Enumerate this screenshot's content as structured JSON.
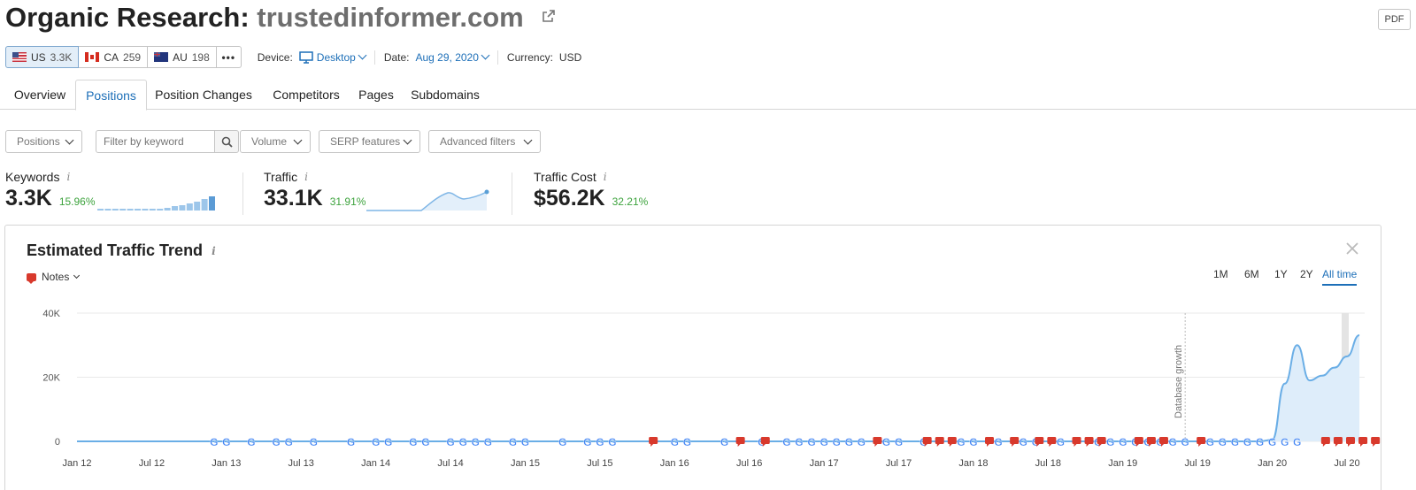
{
  "header": {
    "title_prefix": "Organic Research:",
    "domain": "trustedinformer.com",
    "pdf_label": "PDF"
  },
  "databases": [
    {
      "code": "US",
      "count": "3.3K",
      "flag": "us",
      "active": true
    },
    {
      "code": "CA",
      "count": "259",
      "flag": "ca",
      "active": false
    },
    {
      "code": "AU",
      "count": "198",
      "flag": "au",
      "active": false
    }
  ],
  "more_label": "•••",
  "device": {
    "label": "Device:",
    "value": "Desktop"
  },
  "date": {
    "label": "Date:",
    "value": "Aug 29, 2020"
  },
  "currency": {
    "label": "Currency:",
    "value": "USD"
  },
  "tabs": [
    "Overview",
    "Positions",
    "Position Changes",
    "Competitors",
    "Pages",
    "Subdomains"
  ],
  "active_tab": "Positions",
  "filters": {
    "positions": "Positions",
    "keyword_placeholder": "Filter by keyword",
    "volume": "Volume",
    "serp": "SERP features",
    "advanced": "Advanced filters"
  },
  "metrics": [
    {
      "label": "Keywords",
      "value": "3.3K",
      "change": "15.96%"
    },
    {
      "label": "Traffic",
      "value": "33.1K",
      "change": "31.91%"
    },
    {
      "label": "Traffic Cost",
      "value": "$56.2K",
      "change": "32.21%"
    }
  ],
  "info_glyph": "i",
  "panel": {
    "title": "Estimated Traffic Trend",
    "notes_label": "Notes",
    "periods": [
      "1M",
      "6M",
      "1Y",
      "2Y",
      "All time"
    ],
    "active_period": "All time"
  },
  "colors": {
    "accent": "#1d6fb8",
    "positive": "#3da33d",
    "line": "#6aaee6",
    "area": "#deedfa",
    "note": "#d8392c"
  },
  "chart_data": {
    "type": "area",
    "title": "Estimated Traffic Trend",
    "y_ticks": [
      "40K",
      "20K",
      "0"
    ],
    "ylim": [
      0,
      40000
    ],
    "x_ticks": [
      "Jan 12",
      "Jul 12",
      "Jan 13",
      "Jul 13",
      "Jan 14",
      "Jul 14",
      "Jan 15",
      "Jul 15",
      "Jan 16",
      "Jul 16",
      "Jan 17",
      "Jul 17",
      "Jan 18",
      "Jul 18",
      "Jan 19",
      "Jul 19",
      "Jan 20",
      "Jul 20"
    ],
    "annotation": "Database growth",
    "series": [
      {
        "x": [
          "2012-01",
          "2019-12",
          "2020-01",
          "2020-02",
          "2020-03",
          "2020-04",
          "2020-05",
          "2020-06",
          "2020-07",
          "2020-08"
        ],
        "values": [
          0,
          0,
          500,
          18000,
          30000,
          19000,
          20500,
          23000,
          26500,
          33100
        ]
      }
    ],
    "markers": {
      "google_update": [
        "2012-12",
        "2013-01",
        "2013-03",
        "2013-05",
        "2013-06",
        "2013-08",
        "2013-11",
        "2014-01",
        "2014-02",
        "2014-04",
        "2014-05",
        "2014-07",
        "2014-08",
        "2014-09",
        "2014-10",
        "2014-12",
        "2015-01",
        "2015-04",
        "2015-06",
        "2015-07",
        "2015-08",
        "2016-01",
        "2016-02",
        "2016-05",
        "2016-08",
        "2016-10",
        "2016-11",
        "2016-12",
        "2017-01",
        "2017-02",
        "2017-03",
        "2017-04",
        "2017-06",
        "2017-07",
        "2017-09",
        "2017-12",
        "2018-01",
        "2018-03",
        "2018-05",
        "2018-06",
        "2018-08",
        "2018-11",
        "2018-12",
        "2019-01",
        "2019-02",
        "2019-03",
        "2019-04",
        "2019-05",
        "2019-06",
        "2019-08",
        "2019-09",
        "2019-10",
        "2019-11",
        "2019-12",
        "2020-01",
        "2020-02",
        "2020-03"
      ],
      "notes": [
        "2015-11",
        "2016-06",
        "2016-08",
        "2017-05",
        "2017-09",
        "2017-10",
        "2017-11",
        "2018-02",
        "2018-04",
        "2018-06",
        "2018-07",
        "2018-09",
        "2018-10",
        "2018-11",
        "2019-02",
        "2019-03",
        "2019-04",
        "2019-07",
        "2020-05",
        "2020-06",
        "2020-07",
        "2020-08",
        "2020-09",
        "2020-10",
        "2020-11"
      ]
    }
  }
}
